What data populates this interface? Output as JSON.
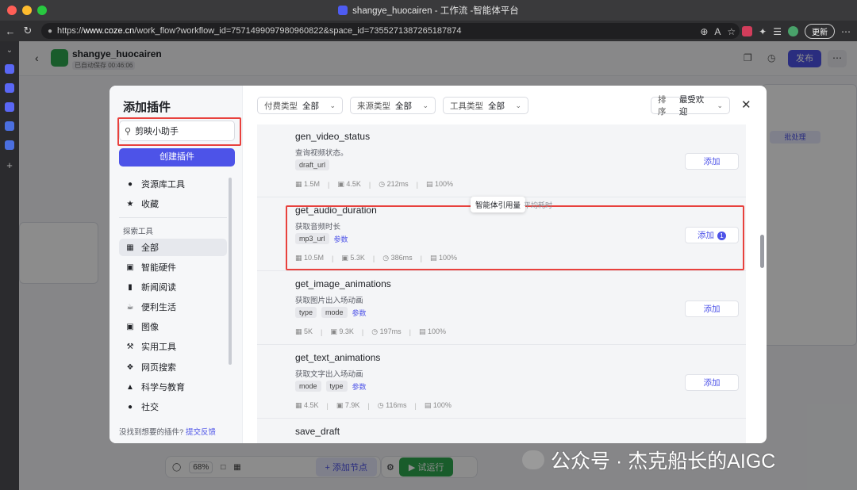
{
  "browser": {
    "tab_title": "shangye_huocairen - 工作流 -智能体平台",
    "url_prefix": "https://",
    "url_host": "www.coze.cn",
    "url_path": "/work_flow?workflow_id=7571499097980960822&space_id=7355271387265187874",
    "update_label": "更新"
  },
  "app": {
    "name": "shangye_huocairen",
    "autosave": "已自动保存 00:46:06",
    "publish_label": "发布",
    "batch_label": "批处理",
    "zoom": "68%",
    "add_node_label": "添加节点",
    "run_label": "试运行"
  },
  "modal": {
    "title": "添加插件",
    "search_value": "剪映小助手",
    "create_label": "创建插件",
    "library_items": [
      {
        "label": "资源库工具",
        "icon": "person-icon"
      },
      {
        "label": "收藏",
        "icon": "star-icon"
      }
    ],
    "explore_label": "探索工具",
    "categories": [
      {
        "label": "全部",
        "icon": "grid-icon"
      },
      {
        "label": "智能硬件",
        "icon": "chip-icon"
      },
      {
        "label": "新闻阅读",
        "icon": "book-icon"
      },
      {
        "label": "便利生活",
        "icon": "cup-icon"
      },
      {
        "label": "图像",
        "icon": "image-icon"
      },
      {
        "label": "实用工具",
        "icon": "wrench-icon"
      },
      {
        "label": "网页搜索",
        "icon": "network-icon"
      },
      {
        "label": "科学与教育",
        "icon": "graduation-icon"
      },
      {
        "label": "社交",
        "icon": "chat-icon"
      }
    ],
    "feedback_text": "没找到想要的插件?",
    "feedback_link": "提交反馈",
    "filters": [
      {
        "label": "付费类型",
        "value": "全部"
      },
      {
        "label": "来源类型",
        "value": "全部"
      },
      {
        "label": "工具类型",
        "value": "全部"
      }
    ],
    "sort": {
      "label": "排序",
      "value": "最受欢迎"
    },
    "tooltip": "智能体引用量",
    "tooltip_ghost": "平均耗时",
    "plugins": [
      {
        "name": "gen_video_status",
        "desc": "查询视频状态。",
        "tags": [
          "draft_url"
        ],
        "has_param": false,
        "stats": [
          "1.5M",
          "4.5K",
          "212ms",
          "100%"
        ],
        "add_label": "添加",
        "badge": ""
      },
      {
        "name": "get_audio_duration",
        "desc": "获取音频时长",
        "tags": [
          "mp3_url"
        ],
        "has_param": true,
        "param_label": "参数",
        "stats": [
          "10.5M",
          "5.3K",
          "386ms",
          "100%"
        ],
        "add_label": "添加",
        "badge": "1"
      },
      {
        "name": "get_image_animations",
        "desc": "获取图片出入场动画",
        "tags": [
          "type",
          "mode"
        ],
        "has_param": true,
        "param_label": "参数",
        "stats": [
          "5K",
          "9.3K",
          "197ms",
          "100%"
        ],
        "add_label": "添加",
        "badge": ""
      },
      {
        "name": "get_text_animations",
        "desc": "获取文字出入场动画",
        "tags": [
          "mode",
          "type"
        ],
        "has_param": true,
        "param_label": "参数",
        "stats": [
          "4.5K",
          "7.9K",
          "116ms",
          "100%"
        ],
        "add_label": "添加",
        "badge": ""
      },
      {
        "name": "save_draft",
        "desc": "",
        "tags": [],
        "has_param": false,
        "stats": [],
        "add_label": "",
        "badge": ""
      }
    ]
  },
  "watermark": "公众号 · 杰克船长的AIGC",
  "colors": {
    "accent": "#4d53e8",
    "highlight": "#e8413d",
    "run": "#2fa84f"
  }
}
